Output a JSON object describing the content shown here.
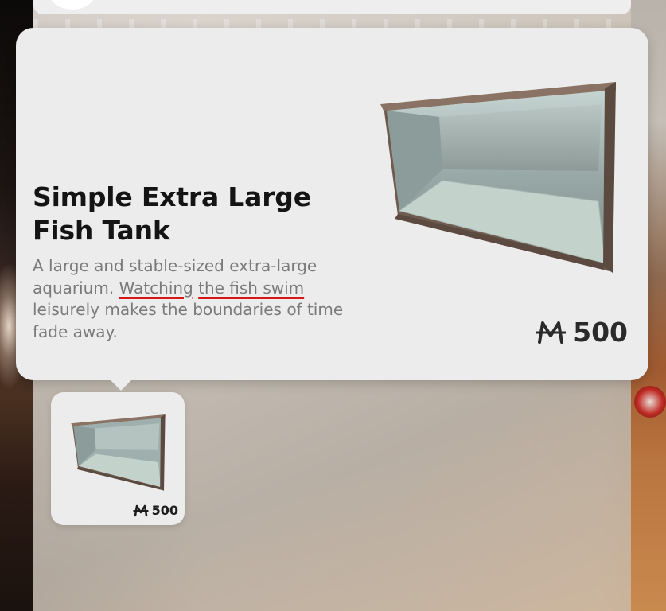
{
  "item": {
    "title": "Simple Extra Large Fish Tank",
    "description_parts": {
      "before": "A large and stable-sized extra-large aquarium. ",
      "watching": "Watching",
      "between": " ",
      "fish_swim": "the fish swim",
      "after": " leisurely makes the boundaries of time fade away."
    },
    "price": "500",
    "currency_icon": "currency-icon"
  },
  "thumbnail": {
    "price": "500"
  },
  "colors": {
    "card": "#ececec",
    "title": "#141414",
    "description": "#7a7a7a",
    "spellcheck_underline": "#d81818"
  }
}
